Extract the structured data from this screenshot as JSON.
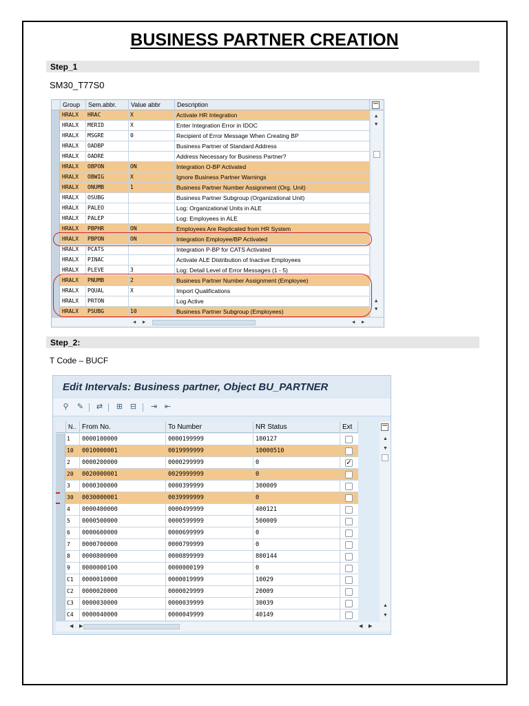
{
  "doc_title": "BUSINESS PARTNER CREATION",
  "step1": {
    "label": "Step_1",
    "transaction": "SM30_T77S0",
    "table": {
      "columns": [
        "Group",
        "Sem.abbr.",
        "Value abbr",
        "Description"
      ],
      "rows": [
        {
          "group": "HRALX",
          "sem": "HRAC",
          "value": "X",
          "desc": "Activate HR Integration",
          "hl": true
        },
        {
          "group": "HRALX",
          "sem": "MERID",
          "value": "X",
          "desc": "Enter Integration Error in IDOC",
          "hl": false
        },
        {
          "group": "HRALX",
          "sem": "MSGRE",
          "value": "0",
          "desc": "Recipient of Error Message When Creating BP",
          "hl": false
        },
        {
          "group": "HRALX",
          "sem": "OADBP",
          "value": "",
          "desc": "Business Partner of Standard Address",
          "hl": false
        },
        {
          "group": "HRALX",
          "sem": "OADRE",
          "value": "",
          "desc": "Address Necessary for Business Partner?",
          "hl": false
        },
        {
          "group": "HRALX",
          "sem": "OBPON",
          "value": "ON",
          "desc": "Integration O-BP Activated",
          "hl": true
        },
        {
          "group": "HRALX",
          "sem": "OBWIG",
          "value": "X",
          "desc": "Ignore Business Partner Warnings",
          "hl": true
        },
        {
          "group": "HRALX",
          "sem": "ONUMB",
          "value": "1",
          "desc": "Business Partner Number Assignment (Org. Unit)",
          "hl": true
        },
        {
          "group": "HRALX",
          "sem": "OSUBG",
          "value": "",
          "desc": "Business Partner Subgroup (Organizational Unit)",
          "hl": false
        },
        {
          "group": "HRALX",
          "sem": "PALEO",
          "value": "",
          "desc": "Log: Organizational Units in ALE",
          "hl": false
        },
        {
          "group": "HRALX",
          "sem": "PALEP",
          "value": "",
          "desc": "Log: Employees in ALE",
          "hl": false
        },
        {
          "group": "HRALX",
          "sem": "PBPHR",
          "value": "ON",
          "desc": "Employees Are Replicated from HR System",
          "hl": true
        },
        {
          "group": "HRALX",
          "sem": "PBPON",
          "value": "ON",
          "desc": "Integration Employee/BP Activated",
          "hl": true
        },
        {
          "group": "HRALX",
          "sem": "PCATS",
          "value": "",
          "desc": "Integration P-BP for CATS Activated",
          "hl": false
        },
        {
          "group": "HRALX",
          "sem": "PINAC",
          "value": "",
          "desc": "Activate ALE Distribution of Inactive Employees",
          "hl": false
        },
        {
          "group": "HRALX",
          "sem": "PLEVE",
          "value": "3",
          "desc": "Log: Detail Level of Error Messages (1 - 5)",
          "hl": false
        },
        {
          "group": "HRALX",
          "sem": "PNUMB",
          "value": "2",
          "desc": "Business Partner Number Assignment (Employee)",
          "hl": true
        },
        {
          "group": "HRALX",
          "sem": "PQUAL",
          "value": "X",
          "desc": "Import Qualifications",
          "hl": false
        },
        {
          "group": "HRALX",
          "sem": "PRTON",
          "value": "",
          "desc": "Log Active",
          "hl": false
        },
        {
          "group": "HRALX",
          "sem": "PSUBG",
          "value": "10",
          "desc": "Business Partner Subgroup (Employees)",
          "hl": true
        }
      ]
    }
  },
  "step2": {
    "label": "Step_2:",
    "tcode": "T Code – BUCF",
    "screen_title": "Edit Intervals: Business partner, Object BU_PARTNER",
    "toolbar_icons": [
      "glasses-icon",
      "pencil-icon",
      "transport-icon",
      "insert-row-icon",
      "delete-row-icon",
      "export-icon",
      "import-icon"
    ],
    "table": {
      "columns": [
        "N..",
        "From No.",
        "To Number",
        "NR Status",
        "Ext"
      ],
      "rows": [
        {
          "n": "1",
          "from": "0000100000",
          "to": "0000199999",
          "status": "100127",
          "ext": false,
          "hl": false
        },
        {
          "n": "10",
          "from": "0010000001",
          "to": "0019999999",
          "status": "10000510",
          "ext": false,
          "hl": true
        },
        {
          "n": "2",
          "from": "0000200000",
          "to": "0000299999",
          "status": "0",
          "ext": true,
          "hl": false
        },
        {
          "n": "20",
          "from": "0020000001",
          "to": "0029999999",
          "status": "0",
          "ext": false,
          "hl": true
        },
        {
          "n": "3",
          "from": "0000300000",
          "to": "0000399999",
          "status": "300009",
          "ext": false,
          "hl": false
        },
        {
          "n": "30",
          "from": "0030000001",
          "to": "0039999999",
          "status": "0",
          "ext": false,
          "hl": true
        },
        {
          "n": "4",
          "from": "0000400000",
          "to": "0000499999",
          "status": "400121",
          "ext": false,
          "hl": false
        },
        {
          "n": "5",
          "from": "0000500000",
          "to": "0000599999",
          "status": "500009",
          "ext": false,
          "hl": false
        },
        {
          "n": "6",
          "from": "0000600000",
          "to": "0000699999",
          "status": "0",
          "ext": false,
          "hl": false
        },
        {
          "n": "7",
          "from": "0000700000",
          "to": "0000799999",
          "status": "0",
          "ext": false,
          "hl": false
        },
        {
          "n": "8",
          "from": "0000800000",
          "to": "0000899999",
          "status": "800144",
          "ext": false,
          "hl": false
        },
        {
          "n": "9",
          "from": "0000000100",
          "to": "0000000199",
          "status": "0",
          "ext": false,
          "hl": false
        },
        {
          "n": "C1",
          "from": "0000010000",
          "to": "0000019999",
          "status": "10029",
          "ext": false,
          "hl": false
        },
        {
          "n": "C2",
          "from": "0000020000",
          "to": "0000029999",
          "status": "20009",
          "ext": false,
          "hl": false
        },
        {
          "n": "C3",
          "from": "0000030000",
          "to": "0000039999",
          "status": "30039",
          "ext": false,
          "hl": false
        },
        {
          "n": "C4",
          "from": "0000040000",
          "to": "0000049999",
          "status": "40149",
          "ext": false,
          "hl": false
        }
      ]
    }
  },
  "colors": {
    "highlight_row": "#f2c88e",
    "table_bg": "#dfebf5",
    "annotation_red": "#d9201f"
  }
}
